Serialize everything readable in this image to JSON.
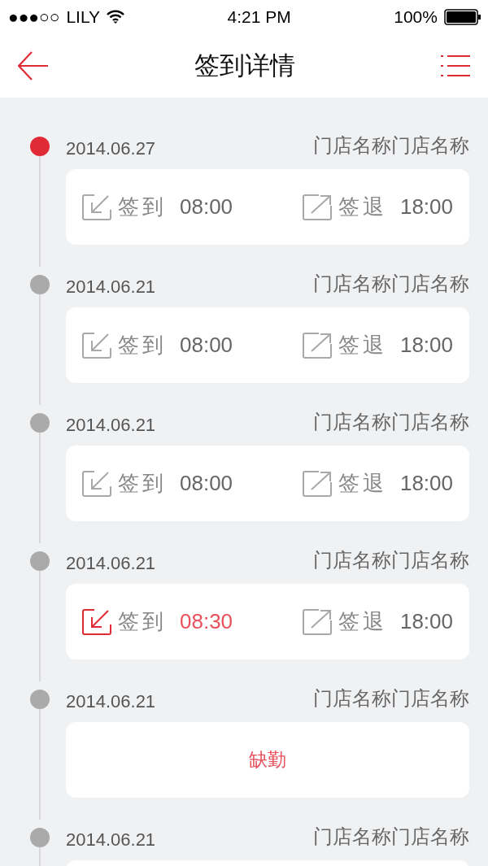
{
  "status_bar": {
    "signal": "●●●○○",
    "carrier": "LILY",
    "time": "4:21 PM",
    "battery": "100%"
  },
  "nav": {
    "title": "签到详情"
  },
  "entries": [
    {
      "date": "2014.06.27",
      "store": "门店名称门店名称",
      "selected": true,
      "kind": "times",
      "check_in": {
        "label": "签到",
        "time": "08:00",
        "late": false
      },
      "check_out": {
        "label": "签退",
        "time": "18:00"
      }
    },
    {
      "date": "2014.06.21",
      "store": "门店名称门店名称",
      "selected": false,
      "kind": "times",
      "check_in": {
        "label": "签到",
        "time": "08:00",
        "late": false
      },
      "check_out": {
        "label": "签退",
        "time": "18:00"
      }
    },
    {
      "date": "2014.06.21",
      "store": "门店名称门店名称",
      "selected": false,
      "kind": "times",
      "check_in": {
        "label": "签到",
        "time": "08:00",
        "late": false
      },
      "check_out": {
        "label": "签退",
        "time": "18:00"
      }
    },
    {
      "date": "2014.06.21",
      "store": "门店名称门店名称",
      "selected": false,
      "kind": "times",
      "check_in": {
        "label": "签到",
        "time": "08:30",
        "late": true
      },
      "check_out": {
        "label": "签退",
        "time": "18:00"
      }
    },
    {
      "date": "2014.06.21",
      "store": "门店名称门店名称",
      "selected": false,
      "kind": "absent",
      "note": "缺勤"
    },
    {
      "date": "2014.06.21",
      "store": "门店名称门店名称",
      "selected": false,
      "kind": "empty"
    }
  ]
}
